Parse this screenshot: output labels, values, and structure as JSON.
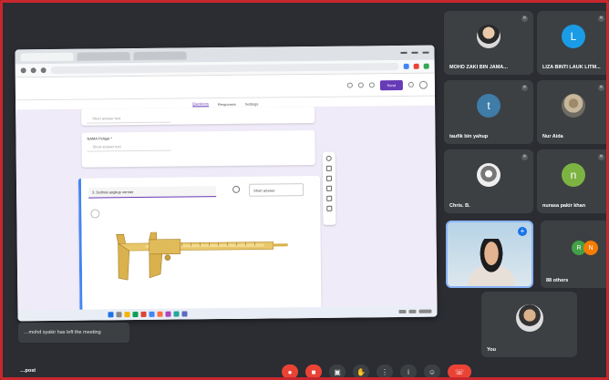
{
  "participants": [
    {
      "name": "MOHD ZAKI BIN JAMA...",
      "kind": "photo",
      "av_class": "photo-av"
    },
    {
      "name": "LIZA BINTI LAUK LITM...",
      "kind": "initial",
      "initial": "L",
      "color": "#1a9be6"
    },
    {
      "name": "taufik bin yahup",
      "kind": "initial",
      "initial": "t",
      "color": "#3f7ca8"
    },
    {
      "name": "Nur Aida",
      "kind": "photo",
      "av_class": "photo-av2"
    },
    {
      "name": "Chris. B.",
      "kind": "photo",
      "av_class": "photo-av3"
    },
    {
      "name": "nurasa pakir khan",
      "kind": "initial",
      "initial": "n",
      "color": "#7cb342"
    },
    {
      "name": "",
      "kind": "camera"
    },
    {
      "name": "88 others",
      "kind": "others"
    },
    {
      "name": "You",
      "kind": "photo",
      "av_class": "photo-av4"
    }
  ],
  "others_avatars": [
    {
      "initial": "R",
      "color": "#43a047"
    },
    {
      "initial": "N",
      "color": "#f57c00"
    }
  ],
  "toast": "…mohd syakir has left the meeting",
  "meeting_name": "…post",
  "form": {
    "tabs": [
      "Questions",
      "Responses",
      "Settings"
    ],
    "send_label": "Send",
    "question_1_answer": "Short answer text",
    "question_2_title": "NAMA Pelajar *",
    "question_2_answer": "Short answer text",
    "active_question": "3. Definisi angkup vernier",
    "question_type": "Short answer"
  },
  "controls": [
    "mic",
    "cam",
    "present",
    "hand",
    "more",
    "info",
    "people",
    "end"
  ]
}
